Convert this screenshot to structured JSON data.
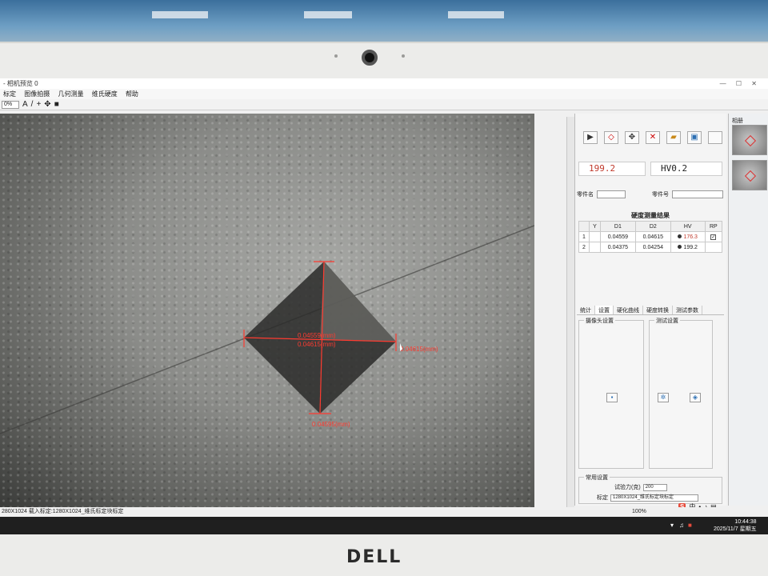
{
  "app": {
    "title": "- 相机预览 0",
    "menu": [
      "标定",
      "图像拍摄",
      "几何测量",
      "维氏硬度",
      "帮助"
    ],
    "zoom_select": "0%"
  },
  "measurement": {
    "d1_label": "0.04559(mm)",
    "d2_label": "0.04615(mm)",
    "tip_label": "0.04595(mm)",
    "line_color": "#ff3b30"
  },
  "panel": {
    "hardness_value": "199.2",
    "scale": "HV0.2",
    "part_name_label": "零件名",
    "part_number_label": "零件号",
    "results_title": "硬度测量结果",
    "table": {
      "headers": [
        "",
        "Y",
        "D1",
        "D2",
        "HV",
        "RP"
      ],
      "rows": [
        {
          "index": "1",
          "y": "",
          "d1": "0.04559",
          "d2": "0.04615",
          "hv": "176.3",
          "rp": "✓"
        },
        {
          "index": "2",
          "y": "",
          "d1": "0.04375",
          "d2": "0.04254",
          "hv": "199.2",
          "rp": ""
        }
      ]
    },
    "tabs": [
      "统计",
      "设置",
      "硬化曲线",
      "硬度转换",
      "测试参数"
    ],
    "group_left_title": "摄像头设置",
    "group_right_title": "测试设置",
    "settings_title": "常用设置",
    "force_label": "试验力(克)",
    "force_value": "200",
    "calib_label": "标定",
    "calib_value": "1280X1024_维氏标定块标定"
  },
  "thumbs": {
    "label": "相册"
  },
  "status": {
    "left": "280X1024  载入标定:1280X1024_维氏标定块标定",
    "zoom": "100%"
  },
  "taskbar": {
    "time": "10:44:38",
    "date": "2025/11/7 星期五"
  },
  "monitor": {
    "brand": "DELL"
  }
}
